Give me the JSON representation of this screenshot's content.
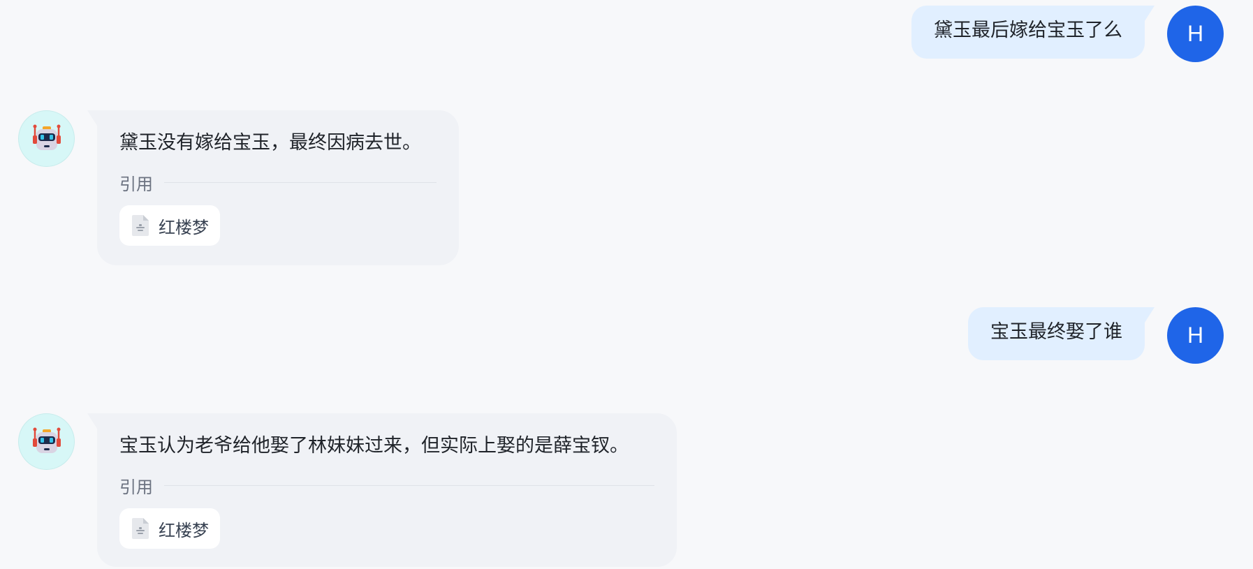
{
  "messages": [
    {
      "role": "user",
      "avatar": "H",
      "text": "黛玉最后嫁给宝玉了么"
    },
    {
      "role": "assistant",
      "avatar_icon": "robot-icon",
      "text": "黛玉没有嫁给宝玉，最终因病去世。",
      "citation_label": "引用",
      "sources": [
        {
          "name": "红楼梦",
          "icon": "document-icon"
        }
      ]
    },
    {
      "role": "user",
      "avatar": "H",
      "text": "宝玉最终娶了谁"
    },
    {
      "role": "assistant",
      "avatar_icon": "robot-icon",
      "text": "宝玉认为老爷给他娶了林妹妹过来，但实际上娶的是薛宝钗。",
      "citation_label": "引用",
      "sources": [
        {
          "name": "红楼梦",
          "icon": "document-icon"
        }
      ]
    }
  ],
  "colors": {
    "background": "#f7f8fa",
    "user_bubble": "#e1efff",
    "user_avatar": "#1f65e8",
    "bot_bubble": "#f0f2f6",
    "bot_avatar_bg": "#d7f7f7"
  }
}
